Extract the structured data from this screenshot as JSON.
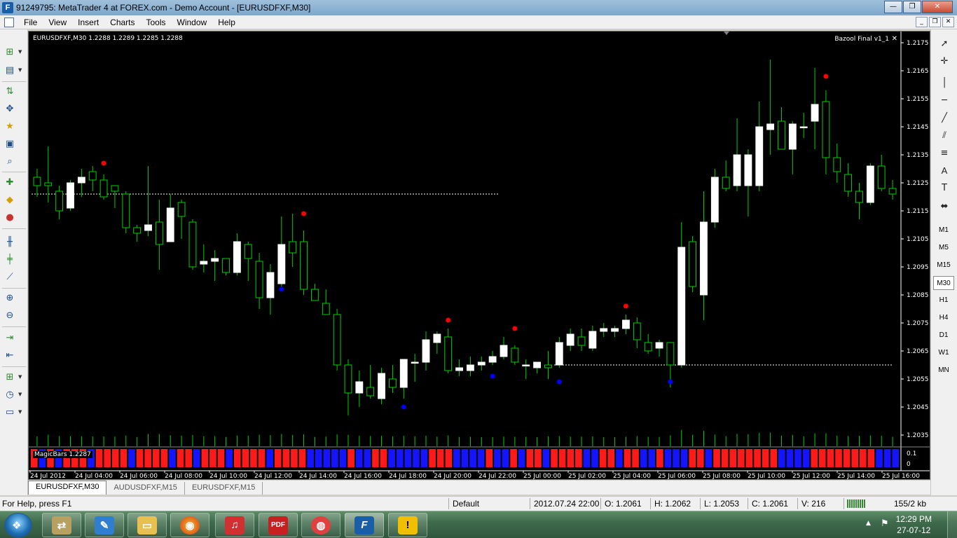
{
  "window": {
    "title": "91249795: MetaTrader 4 at FOREX.com - Demo Account - [EURUSDFXF,M30]",
    "app_icon_letter": "F",
    "buttons": {
      "minimize": "—",
      "maximize": "❐",
      "close": "✕"
    }
  },
  "menu": {
    "items": [
      "File",
      "View",
      "Insert",
      "Charts",
      "Tools",
      "Window",
      "Help"
    ],
    "mdi_buttons": [
      "_",
      "❐",
      "✕"
    ]
  },
  "chart": {
    "symbol_line": "EURUSDFXF,M30  1.2288 1.2289 1.2285 1.2288",
    "indicator_name": "Bazool Final v1_1",
    "indicator_close": "✕",
    "subwindow_label": "MagicBars 1.2287",
    "subwindow_scale": [
      "0.1",
      "0"
    ],
    "colors": {
      "bull_body": "#ffffff",
      "wick": "#00d000",
      "buy_dot": "#0000ff",
      "sell_dot": "#ff0000",
      "level_line": "#ffffff",
      "axis_text": "#ffffff",
      "background": "#000000"
    }
  },
  "chart_data": {
    "type": "candlestick",
    "symbol": "EURUSDFXF",
    "timeframe": "M30",
    "price_axis_ticks": [
      "1.2175",
      "1.2165",
      "1.2155",
      "1.2145",
      "1.2135",
      "1.2125",
      "1.2115",
      "1.2105",
      "1.2095",
      "1.2085",
      "1.2075",
      "1.2065",
      "1.2055",
      "1.2045",
      "1.2035"
    ],
    "time_axis_labels": [
      "24 Jul 2012",
      "24 Jul 04:00",
      "24 Jul 06:00",
      "24 Jul 08:00",
      "24 Jul 10:00",
      "24 Jul 12:00",
      "24 Jul 14:00",
      "24 Jul 16:00",
      "24 Jul 18:00",
      "24 Jul 20:00",
      "24 Jul 22:00",
      "25 Jul 00:00",
      "25 Jul 02:00",
      "25 Jul 04:00",
      "25 Jul 06:00",
      "25 Jul 08:00",
      "25 Jul 10:00",
      "25 Jul 12:00",
      "25 Jul 14:00",
      "25 Jul 16:00"
    ],
    "ylim": [
      1.2031,
      1.2179
    ],
    "candles": [
      [
        1.2127,
        1.213,
        1.212,
        1.2124
      ],
      [
        1.2125,
        1.2138,
        1.2118,
        1.2124
      ],
      [
        1.2122,
        1.2124,
        1.2112,
        1.2115
      ],
      [
        1.2116,
        1.2126,
        1.2115,
        1.2125
      ],
      [
        1.2125,
        1.213,
        1.212,
        1.2127
      ],
      [
        1.2129,
        1.2131,
        1.2122,
        1.2126
      ],
      [
        1.2126,
        1.2128,
        1.2119,
        1.212
      ],
      [
        1.2124,
        1.2124,
        1.2116,
        1.2122
      ],
      [
        1.2121,
        1.2122,
        1.2107,
        1.2109
      ],
      [
        1.2109,
        1.211,
        1.2104,
        1.2107
      ],
      [
        1.2108,
        1.2131,
        1.2106,
        1.211
      ],
      [
        1.2111,
        1.2119,
        1.2094,
        1.2103
      ],
      [
        1.2104,
        1.2121,
        1.2104,
        1.2116
      ],
      [
        1.2118,
        1.2119,
        1.2105,
        1.2113
      ],
      [
        1.2111,
        1.2112,
        1.2094,
        1.2095
      ],
      [
        1.2096,
        1.2103,
        1.2093,
        1.2097
      ],
      [
        1.2097,
        1.2101,
        1.209,
        1.2098
      ],
      [
        1.2098,
        1.2098,
        1.2092,
        1.2093
      ],
      [
        1.2093,
        1.2107,
        1.2092,
        1.2104
      ],
      [
        1.2103,
        1.2104,
        1.209,
        1.2098
      ],
      [
        1.2097,
        1.21,
        1.208,
        1.2084
      ],
      [
        1.2084,
        1.2096,
        1.2078,
        1.2093
      ],
      [
        1.2089,
        1.2113,
        1.2088,
        1.2103
      ],
      [
        1.2104,
        1.2114,
        1.2095,
        1.21
      ],
      [
        1.2104,
        1.2108,
        1.2085,
        1.2087
      ],
      [
        1.2087,
        1.2089,
        1.2083,
        1.2083
      ],
      [
        1.2082,
        1.2087,
        1.2079,
        1.2078
      ],
      [
        1.2078,
        1.208,
        1.2058,
        1.206
      ],
      [
        1.206,
        1.2062,
        1.2042,
        1.205
      ],
      [
        1.205,
        1.2058,
        1.2045,
        1.2054
      ],
      [
        1.2052,
        1.206,
        1.2048,
        1.2049
      ],
      [
        1.2048,
        1.2059,
        1.2046,
        1.2057
      ],
      [
        1.2055,
        1.206,
        1.205,
        1.2052
      ],
      [
        1.2052,
        1.2061,
        1.2048,
        1.2062
      ],
      [
        1.2061,
        1.2064,
        1.2054,
        1.2061
      ],
      [
        1.2061,
        1.2072,
        1.2058,
        1.2069
      ],
      [
        1.2068,
        1.2072,
        1.2064,
        1.2071
      ],
      [
        1.207,
        1.2073,
        1.2057,
        1.2058
      ],
      [
        1.2058,
        1.2062,
        1.2056,
        1.2059
      ],
      [
        1.2058,
        1.2063,
        1.2056,
        1.206
      ],
      [
        1.206,
        1.2063,
        1.2058,
        1.2061
      ],
      [
        1.2061,
        1.2065,
        1.206,
        1.2063
      ],
      [
        1.2063,
        1.207,
        1.2062,
        1.2067
      ],
      [
        1.2066,
        1.2067,
        1.206,
        1.2061
      ],
      [
        1.206,
        1.2062,
        1.2055,
        1.206
      ],
      [
        1.2059,
        1.2061,
        1.2057,
        1.2061
      ],
      [
        1.206,
        1.2065,
        1.2055,
        1.2059
      ],
      [
        1.206,
        1.207,
        1.2059,
        1.2068
      ],
      [
        1.2067,
        1.2073,
        1.2065,
        1.2071
      ],
      [
        1.207,
        1.2073,
        1.2065,
        1.2067
      ],
      [
        1.2066,
        1.2074,
        1.2065,
        1.2072
      ],
      [
        1.2072,
        1.2075,
        1.207,
        1.2073
      ],
      [
        1.2072,
        1.2074,
        1.207,
        1.2073
      ],
      [
        1.2073,
        1.2078,
        1.2071,
        1.2076
      ],
      [
        1.2075,
        1.2077,
        1.2066,
        1.2069
      ],
      [
        1.2068,
        1.2071,
        1.2064,
        1.2065
      ],
      [
        1.2066,
        1.2069,
        1.2063,
        1.2068
      ],
      [
        1.2068,
        1.2068,
        1.2052,
        1.206
      ],
      [
        1.206,
        1.2111,
        1.2059,
        1.2102
      ],
      [
        1.2104,
        1.2106,
        1.2086,
        1.2088
      ],
      [
        1.2085,
        1.2122,
        1.2076,
        1.2111
      ],
      [
        1.2111,
        1.213,
        1.2109,
        1.2127
      ],
      [
        1.2127,
        1.2133,
        1.2122,
        1.2123
      ],
      [
        1.2124,
        1.2148,
        1.2122,
        1.2135
      ],
      [
        1.2124,
        1.2137,
        1.2113,
        1.2135
      ],
      [
        1.2124,
        1.2154,
        1.2122,
        1.2145
      ],
      [
        1.2144,
        1.2169,
        1.2135,
        1.2146
      ],
      [
        1.2147,
        1.2152,
        1.2138,
        1.2137
      ],
      [
        1.2137,
        1.2147,
        1.2128,
        1.2146
      ],
      [
        1.2145,
        1.215,
        1.2141,
        1.2145
      ],
      [
        1.2147,
        1.2166,
        1.2137,
        1.2153
      ],
      [
        1.2154,
        1.2158,
        1.2128,
        1.2134
      ],
      [
        1.2134,
        1.2139,
        1.2125,
        1.2129
      ],
      [
        1.2128,
        1.2132,
        1.212,
        1.2122
      ],
      [
        1.2122,
        1.2125,
        1.2112,
        1.2118
      ],
      [
        1.2118,
        1.2132,
        1.2117,
        1.2131
      ],
      [
        1.2131,
        1.2135,
        1.2122,
        1.2123
      ],
      [
        1.2123,
        1.2126,
        1.2119,
        1.2121
      ]
    ],
    "buy_signals": [
      [
        22,
        1.2087
      ],
      [
        33,
        1.2045
      ],
      [
        41,
        1.2056
      ],
      [
        47,
        1.2054
      ],
      [
        57,
        1.2054
      ]
    ],
    "sell_signals": [
      [
        6,
        1.2132
      ],
      [
        24,
        1.2114
      ],
      [
        37,
        1.2076
      ],
      [
        43,
        1.2073
      ],
      [
        53,
        1.2081
      ],
      [
        71,
        1.2163
      ]
    ],
    "horizontal_levels": [
      1.2121,
      1.206
    ],
    "magic_bars": "RBRBRRRBRRRRBRRRRBRRBRRRBRRRRBRRRRBBBBBRBBRRBBBBBRRRBBBBRBBRBRRBRRRRBBRRBRRBBRBBBRRBRRRRRRRRBBBBRRRRRRRRBBB"
  },
  "tabs": [
    {
      "label": "EURUSDFXF,M30",
      "active": true
    },
    {
      "label": "AUDUSDFXF,M15",
      "active": false
    },
    {
      "label": "EURUSDFXF,M15",
      "active": false
    }
  ],
  "timeframes": [
    "M1",
    "M5",
    "M15",
    "M30",
    "H1",
    "H4",
    "D1",
    "W1",
    "MN"
  ],
  "active_timeframe": "M30",
  "statusbar": {
    "help": "For Help, press F1",
    "profile": "Default",
    "datetime": "2012.07.24 22:00",
    "open": "O: 1.2061",
    "high": "H: 1.2062",
    "low": "L: 1.2053",
    "close": "C: 1.2061",
    "volume": "V: 216",
    "traffic": "155/2 kb"
  },
  "taskbar": {
    "time": "12:29 PM",
    "date": "27-07-12",
    "apps": [
      "explorer",
      "vista-app",
      "folder",
      "firefox",
      "media",
      "pdf",
      "paint",
      "forex",
      "warning"
    ]
  }
}
